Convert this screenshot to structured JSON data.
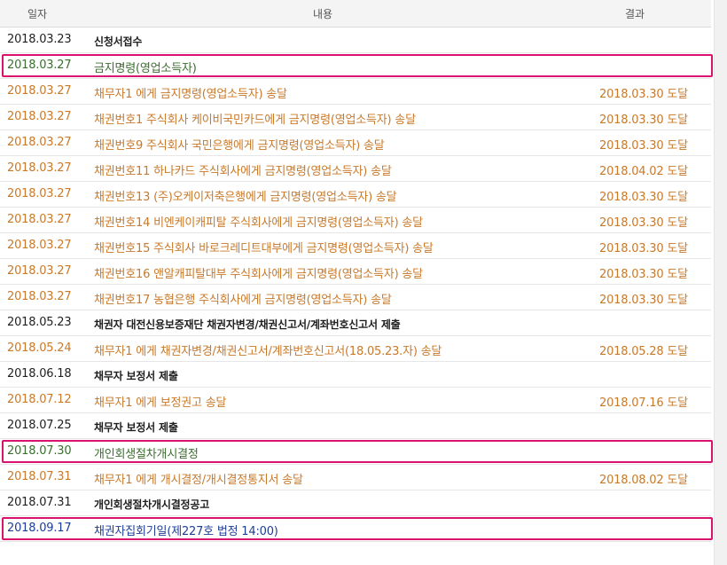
{
  "header": {
    "date": "일자",
    "content": "내용",
    "result": "결과"
  },
  "rows": [
    {
      "date": "2018.03.23",
      "content": "신청서접수",
      "result": "",
      "tone": "black",
      "highlight": false
    },
    {
      "date": "2018.03.27",
      "content": "금지명령(영업소득자)",
      "result": "",
      "tone": "green",
      "highlight": true
    },
    {
      "date": "2018.03.27",
      "content": "채무자1            에게 금지명령(영업소득자) 송달",
      "result": "2018.03.30 도달",
      "tone": "orange",
      "highlight": false
    },
    {
      "date": "2018.03.27",
      "content": "채권번호1 주식회사 케이비국민카드에게 금지명령(영업소득자) 송달",
      "result": "2018.03.30 도달",
      "tone": "orange",
      "highlight": false
    },
    {
      "date": "2018.03.27",
      "content": "채권번호9 주식회사 국민은행에게 금지명령(영업소득자) 송달",
      "result": "2018.03.30 도달",
      "tone": "orange",
      "highlight": false
    },
    {
      "date": "2018.03.27",
      "content": "채권번호11 하나카드 주식회사에게 금지명령(영업소득자) 송달",
      "result": "2018.04.02 도달",
      "tone": "orange",
      "highlight": false
    },
    {
      "date": "2018.03.27",
      "content": "채권번호13 (주)오케이저축은행에게 금지명령(영업소득자) 송달",
      "result": "2018.03.30 도달",
      "tone": "orange",
      "highlight": false
    },
    {
      "date": "2018.03.27",
      "content": "채권번호14 비엔케이캐피탈 주식회사에게 금지명령(영업소득자) 송달",
      "result": "2018.03.30 도달",
      "tone": "orange",
      "highlight": false
    },
    {
      "date": "2018.03.27",
      "content": "채권번호15 주식회사 바로크레디트대부에게 금지명령(영업소득자) 송달",
      "result": "2018.03.30 도달",
      "tone": "orange",
      "highlight": false
    },
    {
      "date": "2018.03.27",
      "content": "채권번호16 앤알캐피탈대부 주식회사에게 금지명령(영업소득자) 송달",
      "result": "2018.03.30 도달",
      "tone": "orange",
      "highlight": false
    },
    {
      "date": "2018.03.27",
      "content": "채권번호17 농협은행 주식회사에게 금지명령(영업소득자) 송달",
      "result": "2018.03.30 도달",
      "tone": "orange",
      "highlight": false
    },
    {
      "date": "2018.05.23",
      "content": "채권자 대전신용보증재단 채권자변경/채권신고서/계좌번호신고서 제출",
      "result": "",
      "tone": "black",
      "highlight": false
    },
    {
      "date": "2018.05.24",
      "content": "채무자1            에게 채권자변경/채권신고서/계좌번호신고서(18.05.23.자) 송달",
      "result": "2018.05.28 도달",
      "tone": "orange",
      "highlight": false
    },
    {
      "date": "2018.06.18",
      "content": "채무자            보정서 제출",
      "result": "",
      "tone": "black",
      "highlight": false
    },
    {
      "date": "2018.07.12",
      "content": "채무자1            에게 보정권고 송달",
      "result": "2018.07.16 도달",
      "tone": "orange",
      "highlight": false
    },
    {
      "date": "2018.07.25",
      "content": "채무자            보정서 제출",
      "result": "",
      "tone": "black",
      "highlight": false
    },
    {
      "date": "2018.07.30",
      "content": "개인회생절차개시결정",
      "result": "",
      "tone": "green",
      "highlight": true
    },
    {
      "date": "2018.07.31",
      "content": "채무자1            에게 개시결정/개시결정통지서 송달",
      "result": "2018.08.02 도달",
      "tone": "orange",
      "highlight": false
    },
    {
      "date": "2018.07.31",
      "content": "개인회생절차개시결정공고",
      "result": "",
      "tone": "black",
      "highlight": false
    },
    {
      "date": "2018.09.17",
      "content": "채권자집회기일(제227호 법정 14:00)",
      "result": "",
      "tone": "blue",
      "highlight": true
    }
  ]
}
